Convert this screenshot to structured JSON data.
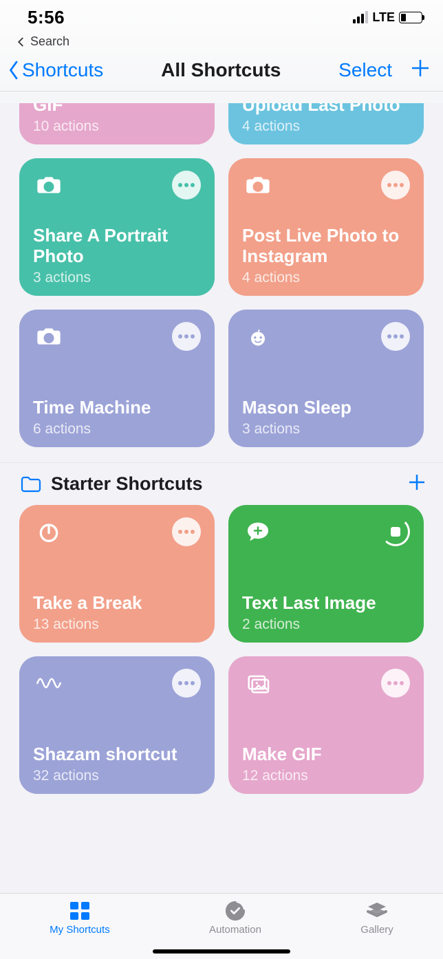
{
  "statusbar": {
    "time": "5:56",
    "network": "LTE"
  },
  "breadcrumb": {
    "label": "Search"
  },
  "navbar": {
    "back": "Shortcuts",
    "title": "All Shortcuts",
    "select": "Select"
  },
  "sections": [
    {
      "header": null,
      "cards": [
        {
          "title": "Convert Burst To GIF",
          "subtitle": "10 actions",
          "color": "#e6a7cc",
          "icon": "camera",
          "more_color": "#e6a7cc",
          "half": true
        },
        {
          "title": "Upload Last Photo",
          "subtitle": "4 actions",
          "color": "#6bc3df",
          "icon": "camera",
          "more_color": "#6bc3df",
          "half": true
        },
        {
          "title": "Share A Portrait Photo",
          "subtitle": "3 actions",
          "color": "#47c0a9",
          "icon": "camera",
          "more_color": "#47c0a9",
          "half": false
        },
        {
          "title": "Post Live Photo to Instagram",
          "subtitle": "4 actions",
          "color": "#f2a08a",
          "icon": "camera",
          "more_color": "#f2a08a",
          "half": false
        },
        {
          "title": "Time Machine",
          "subtitle": "6 actions",
          "color": "#9ca3d7",
          "icon": "camera",
          "more_color": "#9ca3d7",
          "half": false
        },
        {
          "title": "Mason Sleep",
          "subtitle": "3 actions",
          "color": "#9ca3d7",
          "icon": "baby",
          "more_color": "#9ca3d7",
          "half": false
        }
      ]
    },
    {
      "header": "Starter Shortcuts",
      "cards": [
        {
          "title": "Take a Break",
          "subtitle": "13 actions",
          "color": "#f2a08a",
          "icon": "timer",
          "more_color": "#f2a08a",
          "half": false
        },
        {
          "title": "Text Last Image",
          "subtitle": "2 actions",
          "color": "#3fb34f",
          "icon": "message-plus",
          "more_color": "#3fb34f",
          "half": false,
          "running": true
        },
        {
          "title": "Shazam shortcut",
          "subtitle": "32 actions",
          "color": "#9ca3d7",
          "icon": "wave",
          "more_color": "#9ca3d7",
          "half": false
        },
        {
          "title": "Make GIF",
          "subtitle": "12 actions",
          "color": "#e6a7cc",
          "icon": "photos",
          "more_color": "#e6a7cc",
          "half": false
        }
      ]
    }
  ],
  "tabbar": {
    "items": [
      {
        "label": "My Shortcuts",
        "icon": "grid",
        "active": true
      },
      {
        "label": "Automation",
        "icon": "clock-check",
        "active": false
      },
      {
        "label": "Gallery",
        "icon": "stack",
        "active": false
      }
    ]
  }
}
